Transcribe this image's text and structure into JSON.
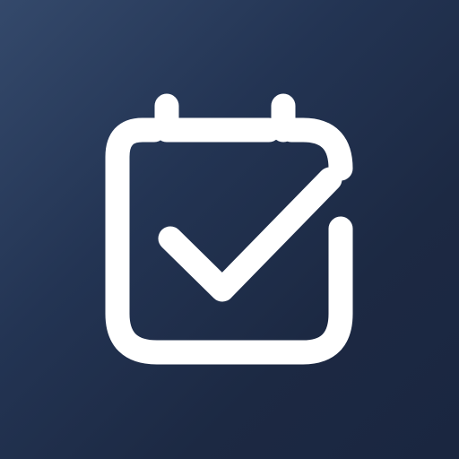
{
  "icon": {
    "name": "calendar-check-icon",
    "glyph_color": "#ffffff",
    "background_colors": [
      "#34496b",
      "#1a2640"
    ]
  }
}
